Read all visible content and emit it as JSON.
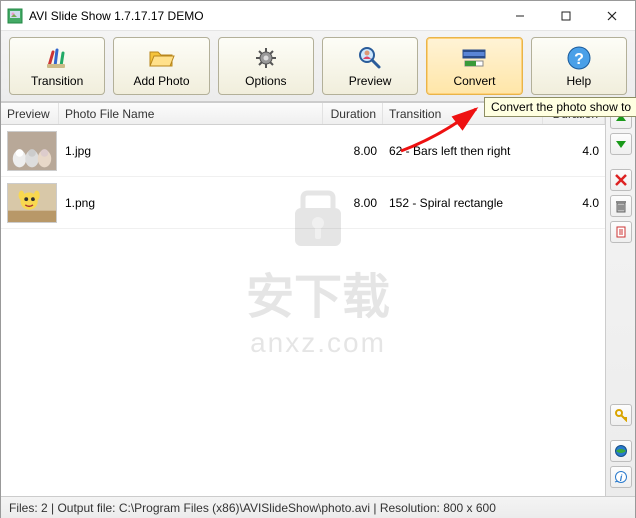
{
  "window": {
    "title": "AVI Slide Show 1.7.17.17 DEMO"
  },
  "toolbar": {
    "transition": "Transition",
    "add_photo": "Add Photo",
    "options": "Options",
    "preview": "Preview",
    "convert": "Convert",
    "help": "Help"
  },
  "tooltip": {
    "convert": "Convert the photo show to"
  },
  "columns": {
    "preview": "Preview",
    "filename": "Photo File Name",
    "duration": "Duration",
    "transition": "Transition",
    "duration2": "Duration"
  },
  "rows": [
    {
      "filename": "1.jpg",
      "duration": "8.00",
      "transition": "62 - Bars left then right",
      "duration2": "4.0"
    },
    {
      "filename": "1.png",
      "duration": "8.00",
      "transition": "152 - Spiral rectangle",
      "duration2": "4.0"
    }
  ],
  "status": {
    "text": "Files: 2 | Output file: C:\\Program Files (x86)\\AVISlideShow\\photo.avi | Resolution: 800 x 600"
  },
  "watermark": {
    "line1": "安下载",
    "line2": "anxz.com"
  },
  "side": {
    "up": "move-up",
    "down": "move-down",
    "delete": "delete",
    "trash": "clear-all",
    "doc": "properties",
    "key": "register",
    "globe": "web",
    "info": "about"
  }
}
